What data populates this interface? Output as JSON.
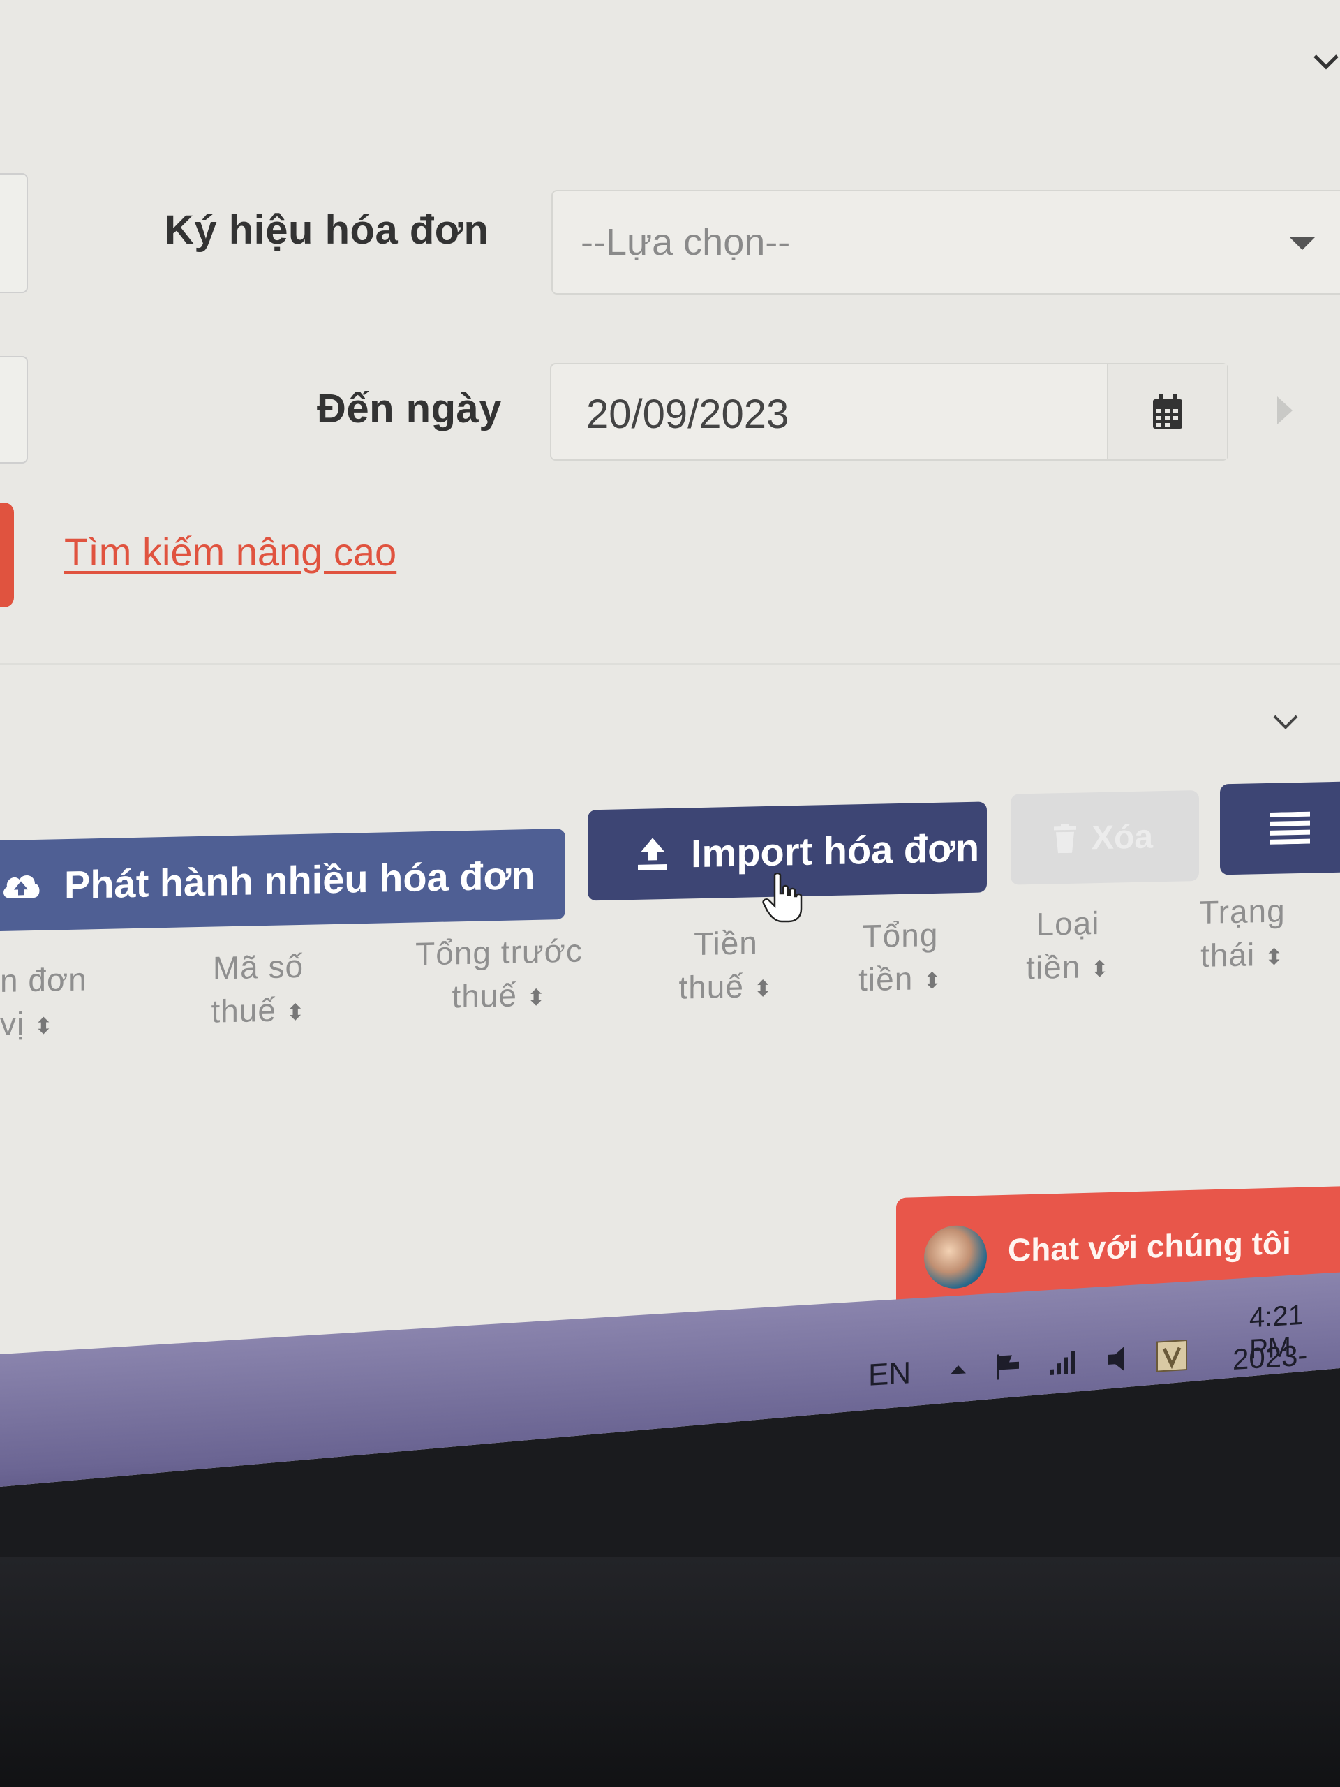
{
  "form": {
    "invoice_symbol_label": "Ký hiệu hóa đơn",
    "invoice_symbol_placeholder": "--Lựa chọn--",
    "to_date_label": "Đến ngày",
    "to_date_value": "20/09/2023",
    "advanced_search": "Tìm kiếm nâng cao"
  },
  "toolbar": {
    "publish_many_label": "Phát hành nhiều hóa đơn",
    "import_label": "Import hóa đơn",
    "delete_label": "Xóa"
  },
  "table": {
    "headers": [
      {
        "line1": "n đơn",
        "line2": "vị"
      },
      {
        "line1": "Mã số",
        "line2": "thuế"
      },
      {
        "line1": "Tổng trước",
        "line2": "thuế"
      },
      {
        "line1": "Tiền",
        "line2": "thuế"
      },
      {
        "line1": "Tổng",
        "line2": "tiền"
      },
      {
        "line1": "Loại",
        "line2": "tiền"
      },
      {
        "line1": "Trạng",
        "line2": "thái"
      }
    ]
  },
  "chat": {
    "label": "Chat với chúng tôi"
  },
  "taskbar": {
    "language": "EN",
    "time": "4:21 PM",
    "date": "2023-09-"
  },
  "colors": {
    "accent_red": "#e0533f",
    "button_primary": "#4f5f94",
    "button_dark": "#3d4574"
  }
}
